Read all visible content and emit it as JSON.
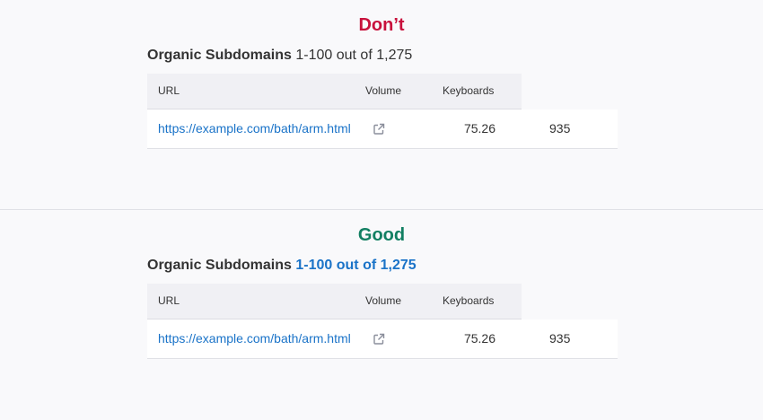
{
  "dont": {
    "verdict": "Don’t",
    "heading_title": "Organic Subdomains",
    "heading_count": "1-100 out of 1,275",
    "columns": {
      "url": "URL",
      "volume": "Volume",
      "keyboards": "Keyboards"
    },
    "row": {
      "url": "https://example.com/bath/arm.html",
      "volume": "75.26",
      "keyboards": "935"
    }
  },
  "good": {
    "verdict": "Good",
    "heading_title": "Organic Subdomains",
    "heading_count": "1-100 out of 1,275",
    "columns": {
      "url": "URL",
      "volume": "Volume",
      "keyboards": "Keyboards"
    },
    "row": {
      "url": "https://example.com/bath/arm.html",
      "volume": "75.26",
      "keyboards": "935"
    }
  },
  "colors": {
    "dont": "#c8113c",
    "good": "#127f62",
    "link": "#1a73c8"
  },
  "icons": {
    "external_link": "external-link-icon"
  }
}
